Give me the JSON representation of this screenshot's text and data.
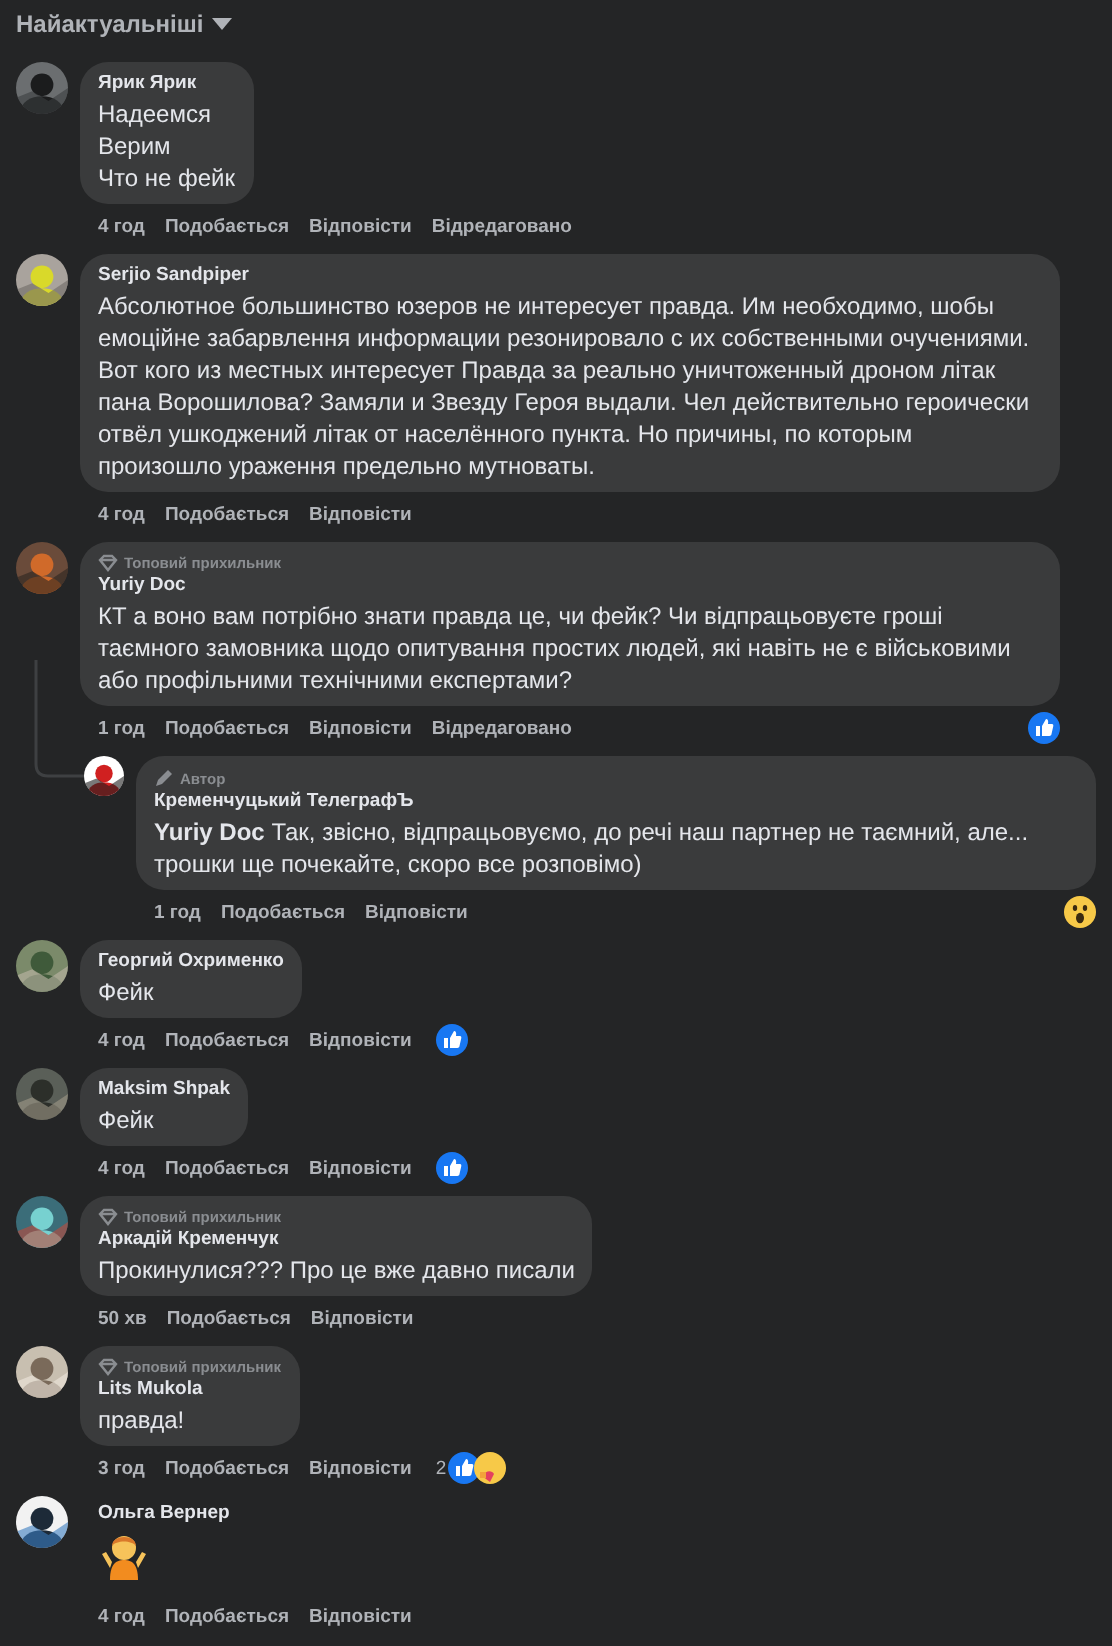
{
  "sort": {
    "label": "Найактуальніші"
  },
  "comments": [
    {
      "author": "Ярик Ярик",
      "body": "Надеемся\nВерим\nЧто не фейк",
      "time": "4 год",
      "actions": [
        "Подобається",
        "Відповісти"
      ],
      "edited": "Відредаговано"
    },
    {
      "author": "Serjio Sandpiper",
      "body": "Абсолютное большинство юзеров не интересует правда. Им необходимо, шобы емоційне забарвлення информации резонировало с их собственными очучениями. Вот кого из местных интересует Правда за реально уничтоженный дроном літак пана Ворошилова? Замяли и Звезду Героя выдали. Чел действительно героически отвёл ушкоджений літак от населённого пункта. Но причины, по которым произошло ураження предельно мутноваты.",
      "time": "4 год",
      "actions": [
        "Подобається",
        "Відповісти"
      ]
    },
    {
      "badge": {
        "kind": "top-fan",
        "label": "Топовий прихильник"
      },
      "author": "Yuriy Doc",
      "body": "КТ а воно вам потрібно знати правда це, чи фейк? Чи відпрацьовуєте гроші таємного замовника щодо опитування простих людей, які навіть не є військовими або профільними технічними експертами?",
      "time": "1 год",
      "actions": [
        "Подобається",
        "Відповісти"
      ],
      "edited": "Відредаговано",
      "reactions": {
        "icons": [
          {
            "kind": "like"
          }
        ]
      },
      "replies": [
        {
          "badge": {
            "kind": "author",
            "label": "Автор"
          },
          "author": "Кременчуцький ТелеграфЪ",
          "body": "**Yuriy Doc** Так, звісно, відпрацьовуємо, до речі наш партнер не таємний, але... трошки ще почекайте, скоро все розповімо)",
          "time": "1 год",
          "actions": [
            "Подобається",
            "Відповісти"
          ],
          "reactions": {
            "icons": [
              {
                "kind": "wow"
              }
            ]
          }
        }
      ]
    },
    {
      "author": "Георгий Охрименко",
      "body": "Фейк",
      "time": "4 год",
      "actions": [
        "Подобається",
        "Відповісти"
      ],
      "reactions": {
        "icons": [
          {
            "kind": "like"
          }
        ]
      }
    },
    {
      "author": "Maksim Shpak",
      "body": "Фейк",
      "time": "4 год",
      "actions": [
        "Подобається",
        "Відповісти"
      ],
      "reactions": {
        "icons": [
          {
            "kind": "like"
          }
        ]
      }
    },
    {
      "badge": {
        "kind": "top-fan",
        "label": "Топовий прихильник"
      },
      "author": "Аркадій Кременчук",
      "body": "Прокинулися??? Про це вже давно писали",
      "time": "50 хв",
      "actions": [
        "Подобається",
        "Відповісти"
      ]
    },
    {
      "badge": {
        "kind": "top-fan",
        "label": "Топовий прихильник"
      },
      "author": "Lits Mukola",
      "body": "правда!",
      "time": "3 год",
      "actions": [
        "Подобається",
        "Відповісти"
      ],
      "reactions": {
        "count": "2",
        "icons": [
          {
            "kind": "like"
          },
          {
            "kind": "care"
          }
        ]
      }
    },
    {
      "kind": "emoji",
      "author": "Ольга Вернер",
      "time": "4 год",
      "actions": [
        "Подобається",
        "Відповісти"
      ]
    }
  ]
}
